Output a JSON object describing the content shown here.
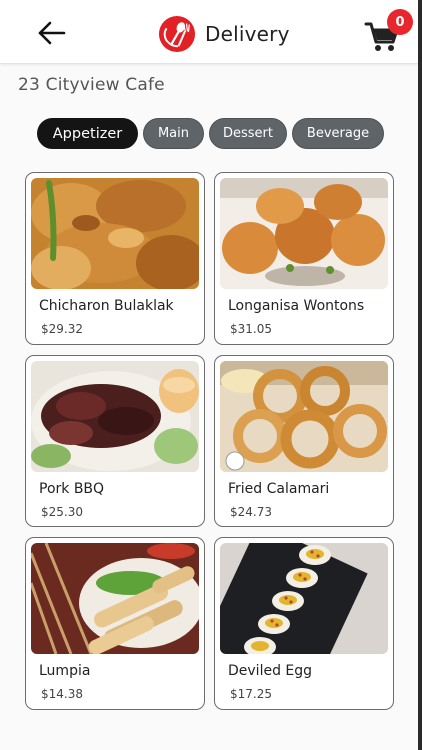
{
  "header": {
    "title": "Delivery",
    "back_icon": "arrow-left-icon",
    "logo_icon": "fork-spoon-logo",
    "cart_icon": "shopping-cart-icon",
    "cart_count": "0"
  },
  "store": {
    "name": "23 Cityview Cafe"
  },
  "tabs": [
    {
      "label": "Appetizer",
      "active": true
    },
    {
      "label": "Main",
      "active": false
    },
    {
      "label": "Dessert",
      "active": false
    },
    {
      "label": "Beverage",
      "active": false
    }
  ],
  "items": [
    {
      "name": "Chicharon Bulaklak",
      "price": "$29.32"
    },
    {
      "name": "Longanisa Wontons",
      "price": "$31.05"
    },
    {
      "name": "Pork BBQ",
      "price": "$25.30"
    },
    {
      "name": "Fried Calamari",
      "price": "$24.73"
    },
    {
      "name": "Lumpia",
      "price": "$14.38"
    },
    {
      "name": "Deviled Egg",
      "price": "$17.25"
    }
  ],
  "colors": {
    "accent": "#e7262d",
    "tab_active": "#141414",
    "tab_inactive": "#5f6468"
  }
}
